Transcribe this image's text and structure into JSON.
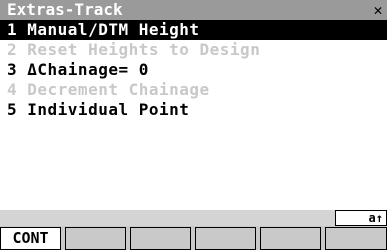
{
  "title": {
    "text": "Extras-Track",
    "close_icon": "✕"
  },
  "menu": {
    "items": [
      {
        "label": "1 Manual/DTM Height",
        "state": "selected"
      },
      {
        "label": "2 Reset Heights to Design",
        "state": "disabled"
      },
      {
        "label": "3 ΔChainage= 0",
        "state": "normal"
      },
      {
        "label": "4 Decrement Chainage",
        "state": "disabled"
      },
      {
        "label": "5 Individual Point",
        "state": "normal"
      }
    ]
  },
  "status": {
    "indicator": "a↑"
  },
  "softkeys": [
    {
      "label": "CONT"
    },
    {
      "label": ""
    },
    {
      "label": ""
    },
    {
      "label": ""
    },
    {
      "label": ""
    },
    {
      "label": ""
    }
  ],
  "colors": {
    "title_bg": "#9a9a9a",
    "selected_bg": "#000000",
    "disabled_text": "#c8c8c8",
    "softkey_bg": "#c9c9c9"
  }
}
